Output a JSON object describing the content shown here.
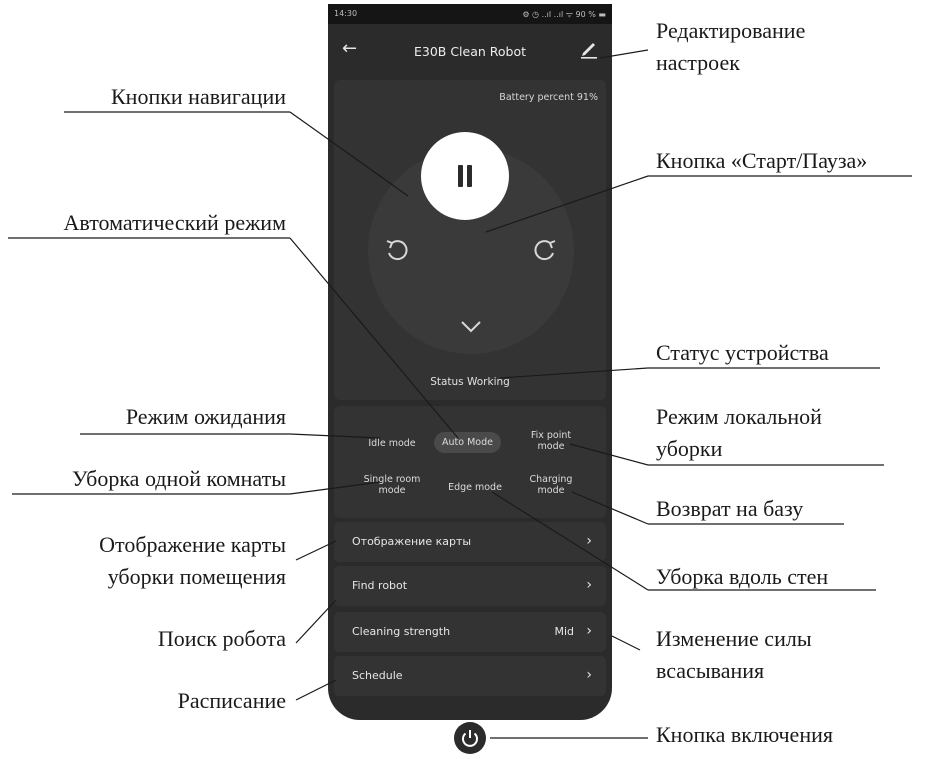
{
  "status_bar": {
    "time": "14:30",
    "indicators": "⚙ ◷ ..ıl ..ıl ᯤ 90 % ▬"
  },
  "app_bar": {
    "title": "E30B Clean Robot",
    "back_icon": "arrow-left",
    "edit_icon": "pencil"
  },
  "control": {
    "battery": "Battery percent 91%",
    "status": "Status Working",
    "play_pause_icon": "pause"
  },
  "modes": {
    "idle": "Idle mode",
    "auto": "Auto Mode",
    "fix_point": "Fix point mode",
    "single_room": "Single room mode",
    "edge": "Edge mode",
    "charging": "Charging mode"
  },
  "list": {
    "map": "Отображение карты",
    "find": "Find robot",
    "strength": "Cleaning strength",
    "strength_value": "Mid",
    "schedule": "Schedule",
    "chevron": "›"
  },
  "annotations": {
    "edit_1": "Редактирование",
    "edit_2": "настроек",
    "nav": "Кнопки навигации",
    "startpause": "Кнопка «Старт/Пауза»",
    "auto": "Автоматический режим",
    "status": "Статус устройства",
    "idle": "Режим ожидания",
    "local_1": "Режим локальной",
    "local_2": "уборки",
    "single_room": "Уборка одной комнаты",
    "return": "Возврат на базу",
    "map_1": "Отображение карты",
    "map_2": "уборки помещения",
    "walls": "Уборка вдоль стен",
    "search": "Поиск робота",
    "suction_1": "Изменение силы",
    "suction_2": "всасывания",
    "schedule": "Расписание",
    "power": "Кнопка включения"
  },
  "colors": {
    "phone_bg": "#2b2b2b",
    "panel_bg": "#333333",
    "accent_white": "#ffffff",
    "text": "#e6e6e6"
  }
}
